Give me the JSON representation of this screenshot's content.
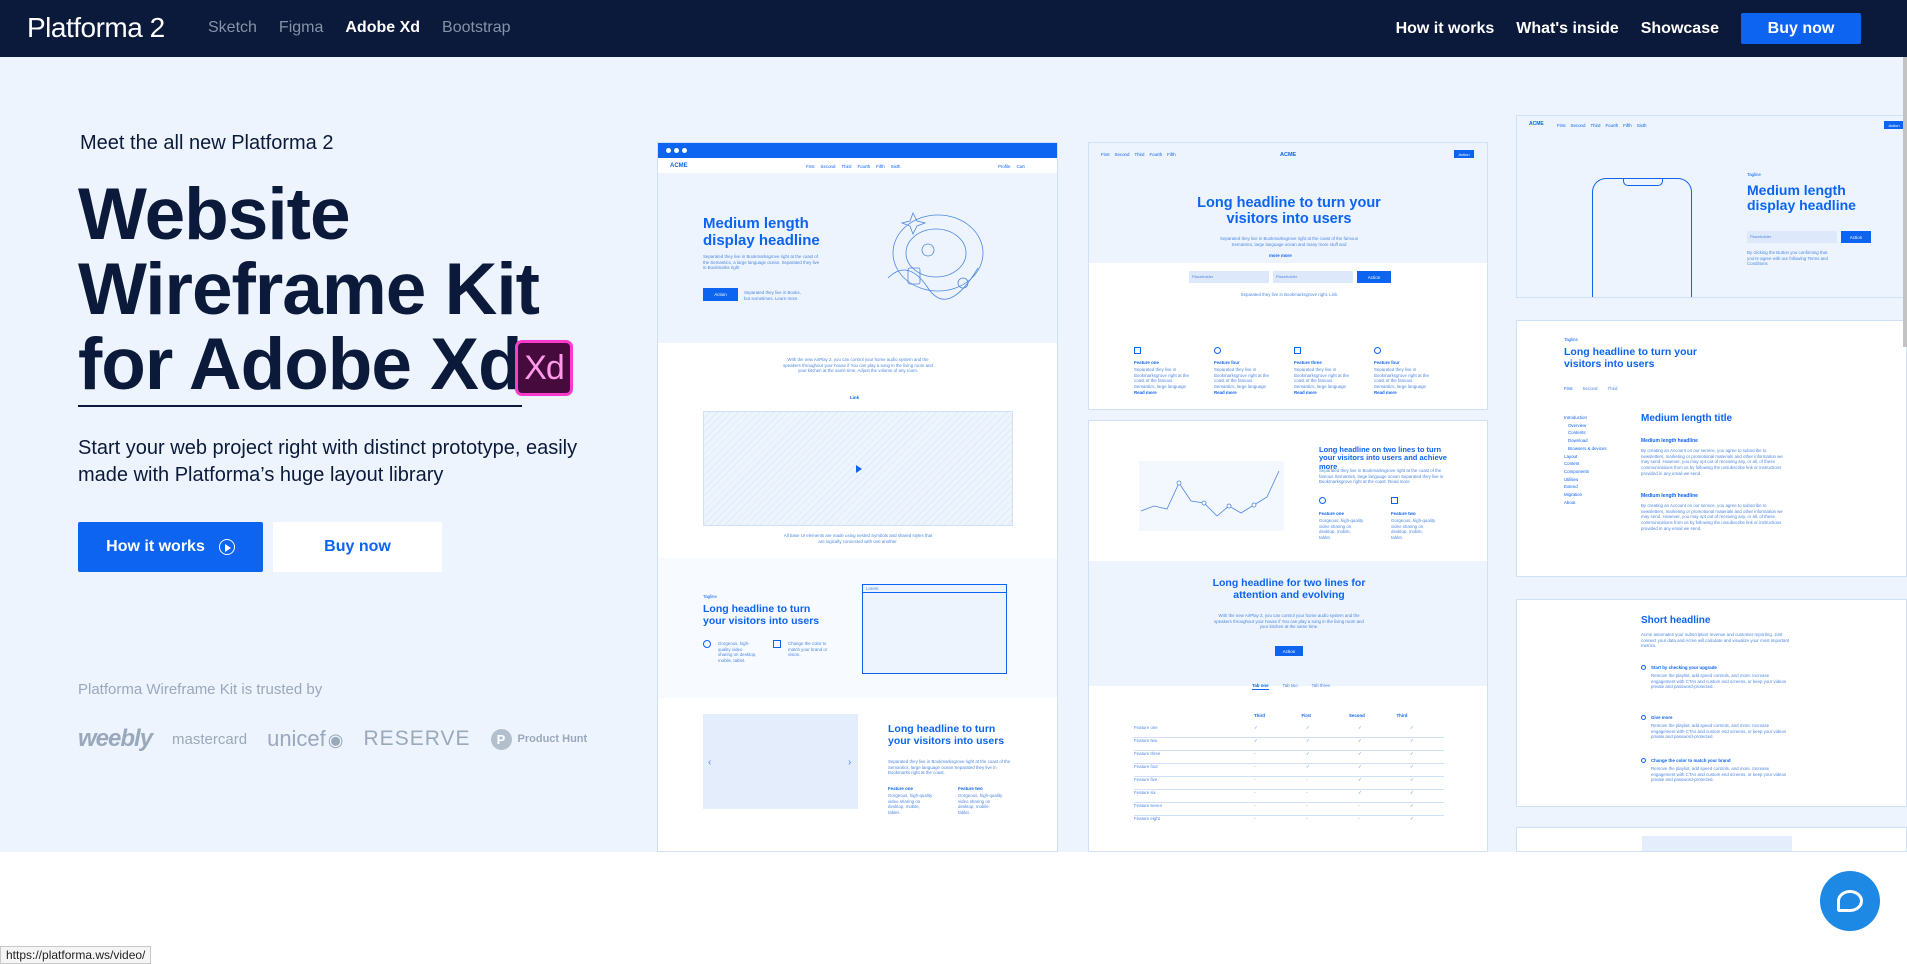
{
  "header": {
    "brand": "Platforma 2",
    "editions": [
      "Sketch",
      "Figma",
      "Adobe Xd",
      "Bootstrap"
    ],
    "active_edition": "Adobe Xd",
    "nav": [
      "How it works",
      "What's inside",
      "Showcase"
    ],
    "buy_label": "Buy now"
  },
  "hero": {
    "eyebrow": "Meet the all new Platforma 2",
    "headline_1": "Website",
    "headline_2": "Wireframe Kit",
    "headline_3": "for Adobe Xd",
    "badge": "Xd",
    "subtitle": "Start your web project right with distinct prototype, easily made with Platforma’s huge layout library",
    "how_label": "How it works",
    "buy_label": "Buy now",
    "trusted": "Platforma Wireframe Kit is trusted by",
    "logos": [
      "weebly",
      "mastercard",
      "unicef",
      "RESERVE",
      "Product Hunt"
    ]
  },
  "preview": {
    "a_logo": "ACME",
    "a_nav": [
      "First",
      "Second",
      "Third",
      "Fourth",
      "Fifth",
      "Sixth"
    ],
    "a_right": [
      "Profile",
      "Cart"
    ],
    "a_h1": "Medium length display headline",
    "a_p1": "Separated they live in Bookmarksgrove right at the coast of the Semantics, a large language ocean. Separated they live in Bookmarks right",
    "a_btn": "Action",
    "a_note": "Separated they live in Books, but sometimes. Learn more",
    "a_p2": "With the new AirPlay 2, you can control your home audio system and the speakers throughout your house if You can play a song in the living room and your kitchen at the same time. Adjust the volume of any room.",
    "a_link": "Link",
    "a_caption": "All base UI elements are made using nested Symbols and shared styles that are logically connected with one another.",
    "a_tag": "Tagline",
    "a_h2": "Long headline to turn your visitors into users",
    "a_f1": "Gorgeous, high-quality video sharing on desktop, mobile, tablet.",
    "a_f2": "Change the color to match your brand or vision.",
    "a_box": "Lorem",
    "a_h3": "Long headline to turn your visitors into users",
    "a_p3": "Separated they live in Bookmarksgrove right at the coast of the Semantics, large language ocean Separated they live in Bookmarks right at the coast.",
    "a_f3": "Feature one",
    "a_f4": "Feature two",
    "a_f5": "Gorgeous, high-quality video sharing on desktop, mobile, tablet.",
    "b_nav": [
      "First",
      "Second",
      "Third",
      "Fourth",
      "Fifth"
    ],
    "b_logo": "ACME",
    "b_btn": "Action",
    "b_h1": "Long headline to turn your visitors into users",
    "b_p1": "Separated they live in Bookmarksgrove right at the coast of the famous Semantics, large language ocean and many more stuff and",
    "b_more": "more more",
    "b_input1": "Placeholder",
    "b_input2": "Placeholder",
    "b_action": "Action",
    "b_note": "Separated they live in Bookmarksgrove right. Link",
    "b_features": [
      "Feature one",
      "Feature four",
      "Feature three",
      "Feature four"
    ],
    "b_ftext": "Separated they live in Bookmarksgrove right at the coast of the famous Semantics, large language",
    "b_read": "Read more",
    "b_h2": "Long headline on two lines to turn your visitors into users and achieve more",
    "b_p2": "Separated they live in Bookmarksgrove right at the coast of the famous Semantics, large language ocean Separated they live in Bookmarksgrove right at the coast. Read more",
    "b_fa": "Feature one",
    "b_fb": "Feature two",
    "b_fc": "Gorgeous, high-quality video sharing on desktop, mobile, tablet.",
    "b_h3": "Long headline for two lines for attention and evolving",
    "b_p3": "With the new AirPlay 2, you can control your home audio system and the speakers throughout your house if You can play a song in the living room and your kitchen at the same time.",
    "b_action2": "Action",
    "b_tabs": [
      "Tab one",
      "Tab two",
      "Tab three"
    ],
    "b_cols": [
      "Third",
      "First",
      "Second",
      "Third"
    ],
    "b_rows": [
      "Feature one",
      "Feature two",
      "Feature three",
      "Feature four",
      "Feature five",
      "Feature six",
      "Feature seven",
      "Feature eight"
    ],
    "c_logo": "ACME",
    "c_nav": [
      "First",
      "Second",
      "Third",
      "Fourth",
      "Fifth",
      "Sixth"
    ],
    "c_btn": "Action",
    "c_tag": "Tagline",
    "c_h1": "Medium length display headline",
    "c_input": "Placeholder",
    "c_note": "By clicking the Button you confirming that you’re agree with our following Terms and Conditions",
    "c_tag2": "Tagline",
    "c_h2": "Long headline to turn your visitors into users",
    "c_crumbs": [
      "First",
      "Second",
      "Third"
    ],
    "c_side": [
      "Introduction",
      "Overview",
      "Contents",
      "Download",
      "Browsers & devices",
      "Layout",
      "Content",
      "Components",
      "Utilities",
      "Extend",
      "Migration",
      "About"
    ],
    "c_title": "Medium length title",
    "c_sub1": "Medium length headline",
    "c_body": "By creating an Account on our service, you agree to subscribe to newsletters, marketing or promotional materials and other information we may send. However, you may opt out of receiving any, or all, of these communications from us by following the unsubscribe link or instructions provided in any email we send.",
    "c_sub2": "Medium length headline",
    "c_h3": "Short headline",
    "c_p3": "Acme automates your subscription revenue and customer reporting. Just connect your data and Acme will calculate and visualize your most important metrics.",
    "c_steps": [
      "Start by checking your upgrade",
      "Give more",
      "Change the color to match your brand"
    ],
    "c_steptext": "Remove the playlist, add speed controls, and more. Increase engagement with CTAs and custom end screens, or keep your videos private and password-protected."
  },
  "status_url": "https://platforma.ws/video/"
}
